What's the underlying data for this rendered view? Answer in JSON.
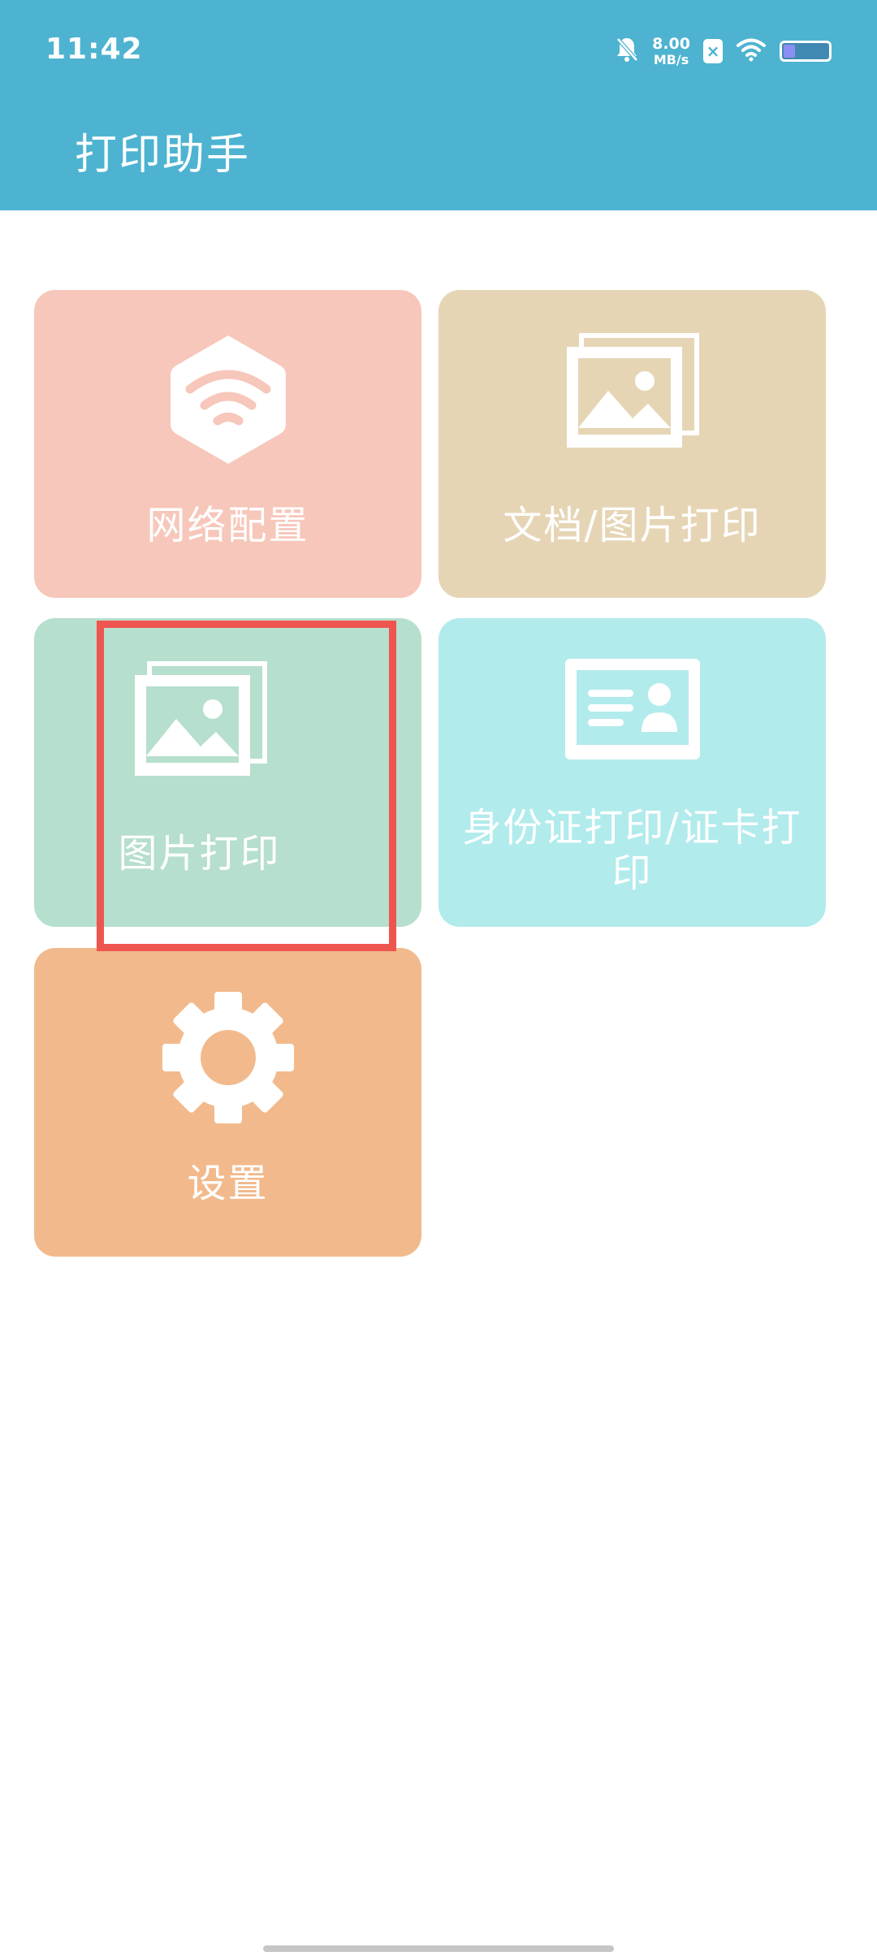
{
  "status_bar": {
    "time": "11:42",
    "net_speed_value": "8.00",
    "net_speed_unit": "MB/s",
    "sim_badge": "×",
    "icons": [
      "bell-off-icon",
      "sim-x-icon",
      "wifi-icon",
      "battery-icon"
    ]
  },
  "app_bar": {
    "title": "打印助手"
  },
  "tiles": [
    {
      "label": "网络配置",
      "icon": "wifi-hex-icon",
      "color": "#f6c7ba"
    },
    {
      "label": "文档/图片打印",
      "icon": "image-stack-icon",
      "color": "#e6d5b5"
    },
    {
      "label": "图片打印",
      "icon": "image-stack-icon",
      "color": "#b6dfcd"
    },
    {
      "label": "身份证打印/证卡打印",
      "icon": "id-card-icon",
      "color": "#b2ebec"
    },
    {
      "label": "设置",
      "icon": "gear-icon",
      "color": "#f2ba8c"
    }
  ],
  "colors": {
    "primary": "#4db3d1",
    "highlight": "#ef554f"
  }
}
